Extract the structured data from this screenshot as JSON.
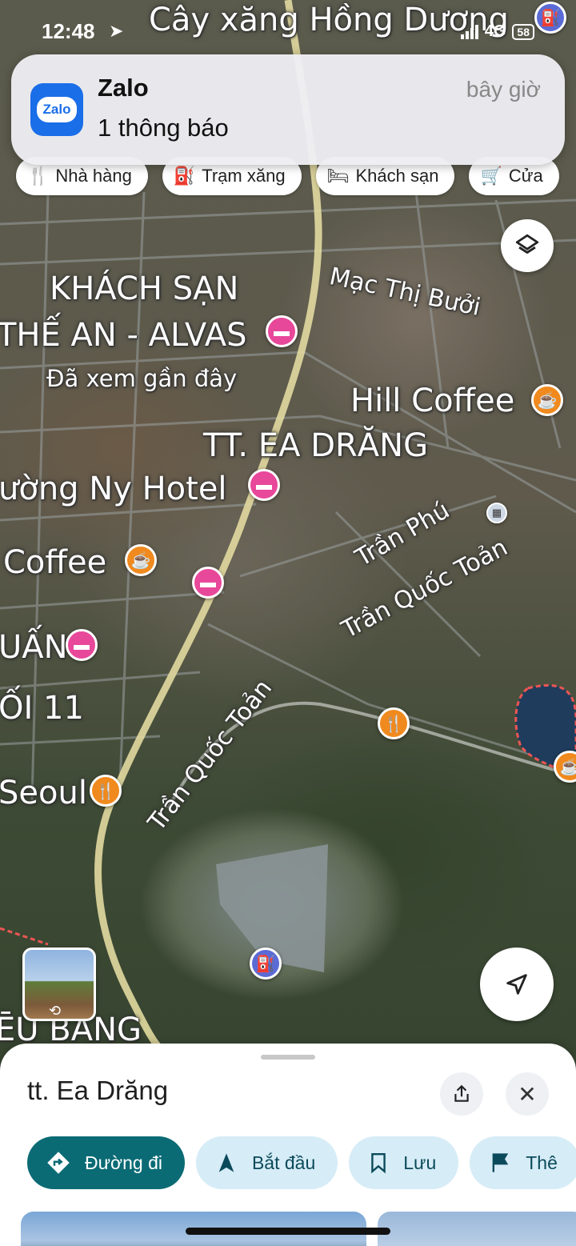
{
  "status_bar": {
    "time": "12:48",
    "network": "4G",
    "battery": "58"
  },
  "notification": {
    "app_icon_text": "Zalo",
    "title": "Zalo",
    "body": "1 thông báo",
    "time": "bây giờ"
  },
  "chips": [
    {
      "label": "Nhà hàng",
      "icon": "fork-knife-icon"
    },
    {
      "label": "Trạm xăng",
      "icon": "gas-pump-icon"
    },
    {
      "label": "Khách sạn",
      "icon": "bed-icon"
    },
    {
      "label": "Cửa",
      "icon": "cart-icon"
    }
  ],
  "map": {
    "labels": {
      "gas_station_top": "Cây xăng Hồng Dương",
      "street_mac_thi_buoi": "Mạc Thị Bưởi",
      "hotel_the_an_line1": "KHÁCH SẠN",
      "hotel_the_an_line2": "THẾ AN - ALVAS",
      "recently_viewed": "Đã xem gần đây",
      "hill_coffee": "Hill Coffee",
      "town": "TT. EA DRĂNG",
      "ny_hotel": "ường Ny Hotel",
      "street_tran_phu": "Trần Phú",
      "street_tran_quoc_toan_1": "Trần Quốc Toản",
      "coffee_left": "Coffee",
      "street_tran_quoc_toan_2": "Trần Quốc Toản",
      "uan": "UẤN",
      "oi11": "ỐI 11",
      "seoul": "Seoul",
      "bang": "ĒU BANG"
    }
  },
  "bottom_sheet": {
    "title": "tt. Ea Drăng",
    "actions": [
      {
        "label": "Đường đi",
        "icon": "directions-icon"
      },
      {
        "label": "Bắt đầu",
        "icon": "navigation-arrow-icon"
      },
      {
        "label": "Lưu",
        "icon": "bookmark-icon"
      },
      {
        "label": "Thê",
        "icon": "flag-icon"
      }
    ]
  }
}
